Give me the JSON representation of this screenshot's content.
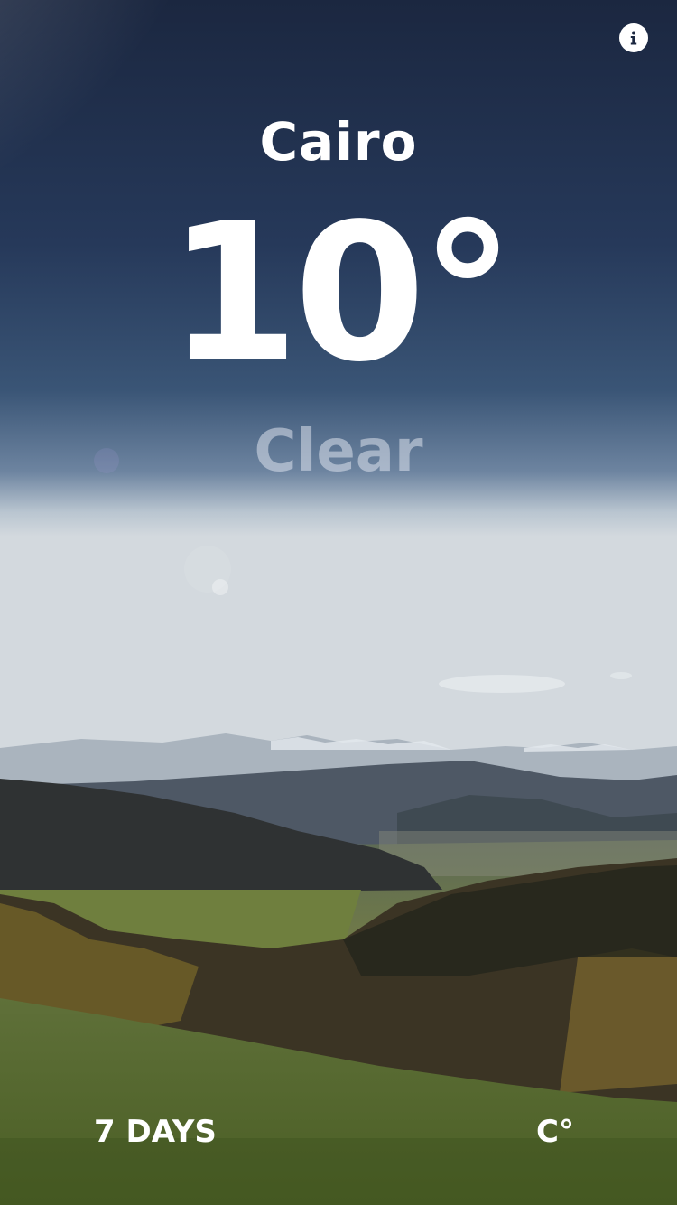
{
  "weather": {
    "city": "Cairo",
    "temperature": "10°",
    "condition": "Clear"
  },
  "footer": {
    "forecast_label": "7 DAYS",
    "unit_label": "C°"
  },
  "icons": {
    "info": "info-icon"
  },
  "colors": {
    "sky_top": "#1c2a44",
    "sky_mid": "#3a5577",
    "horizon": "#c9d2da",
    "grass": "#6a7a2e",
    "text": "#ffffff",
    "condition_text": "#dce2ec"
  }
}
